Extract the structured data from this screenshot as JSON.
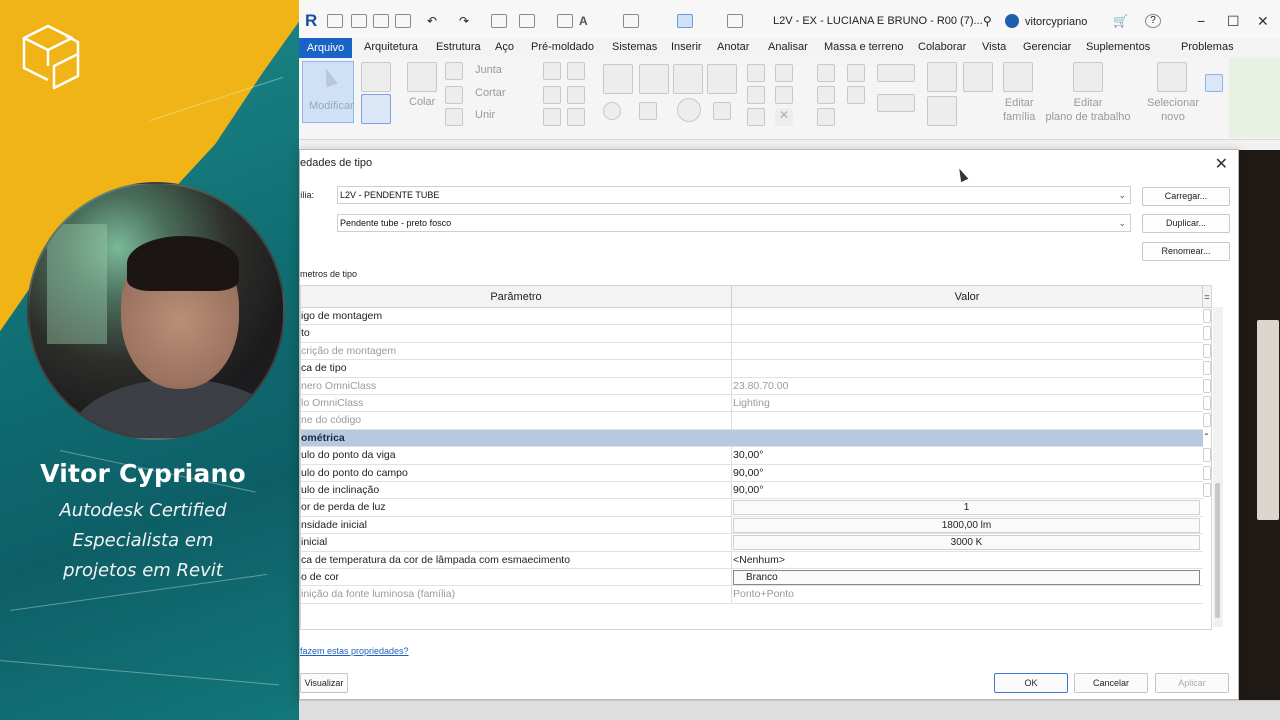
{
  "presenter": {
    "name": "Vitor Cypriano",
    "title_lines": [
      "Autodesk Certified",
      "Especialista em",
      "projetos em Revit"
    ]
  },
  "app": {
    "logo": "R",
    "document_title": "L2V - EX - LUCIANA E BRUNO - R00 (7)...",
    "user_name": "vitorcypriano",
    "window_controls": [
      "−",
      "☐",
      "✕"
    ]
  },
  "menu": {
    "active": "Arquivo",
    "items": [
      "Arquitetura",
      "Estrutura",
      "Aço",
      "Pré-moldado",
      "Sistemas",
      "Inserir",
      "Anotar",
      "Analisar",
      "Massa e terreno",
      "Colaborar",
      "Vista",
      "Gerenciar",
      "Suplementos",
      "Problemas"
    ]
  },
  "ribbon": {
    "modify": "Modificar",
    "paste": "Colar",
    "join": "Junta",
    "cut": "Cortar",
    "unite": "Unir",
    "edit_family": [
      "Editar",
      "família"
    ],
    "edit_workplane": [
      "Editar",
      "plano de trabalho"
    ],
    "select_new": [
      "Selecionar",
      "novo"
    ]
  },
  "dialog": {
    "title": "edades de tipo",
    "family_label": "ília:",
    "family_value": "L2V - PENDENTE TUBE",
    "type_value": "Pendente tube - preto fosco",
    "load_button": "Carregar...",
    "duplicate_button": "Duplicar...",
    "rename_button": "Renomear...",
    "type_params_label": "metros de tipo",
    "col_param": "Parâmetro",
    "col_value": "Valor",
    "rows": [
      {
        "param": "igo de montagem",
        "value": "",
        "style": "normal"
      },
      {
        "param": "to",
        "value": "",
        "style": "normal"
      },
      {
        "param": "crição de montagem",
        "value": "",
        "style": "dim"
      },
      {
        "param": "ca de tipo",
        "value": "",
        "style": "normal"
      },
      {
        "param": "nero OmniClass",
        "value": "23.80.70.00",
        "style": "dim"
      },
      {
        "param": "lo OmniClass",
        "value": "Lighting",
        "style": "dim"
      },
      {
        "param": "ne do código",
        "value": "",
        "style": "dim"
      },
      {
        "param": "ométrica",
        "value": "",
        "style": "group"
      },
      {
        "param": "ulo do ponto da viga",
        "value": "30,00°",
        "style": "normal"
      },
      {
        "param": "ulo do ponto do campo",
        "value": "90,00°",
        "style": "normal"
      },
      {
        "param": "ulo de inclinação",
        "value": "90,00°",
        "style": "normal"
      },
      {
        "param": "or de perda de luz",
        "value": "1",
        "style": "box"
      },
      {
        "param": "nsidade inicial",
        "value": "1800,00 lm",
        "style": "box"
      },
      {
        "param": "inicial",
        "value": "3000 K",
        "style": "box"
      },
      {
        "param": "ca de temperatura da cor de lâmpada com esmaecimento",
        "value": "<Nenhum>",
        "style": "normal"
      },
      {
        "param": "o de cor",
        "value": "Branco",
        "style": "boxleft"
      },
      {
        "param": "inição da fonte luminosa (família)",
        "value": "Ponto+Ponto",
        "style": "dim"
      }
    ],
    "help_link": "fazem estas propriedades?",
    "preview_button": "Visualizar",
    "ok_button": "OK",
    "cancel_button": "Cancelar",
    "apply_button": "Aplicar"
  },
  "colors": {
    "teal": "#0f6d72",
    "yellow": "#f0b417",
    "revit_blue": "#1a63c6",
    "group_row": "#b6c9e0"
  }
}
